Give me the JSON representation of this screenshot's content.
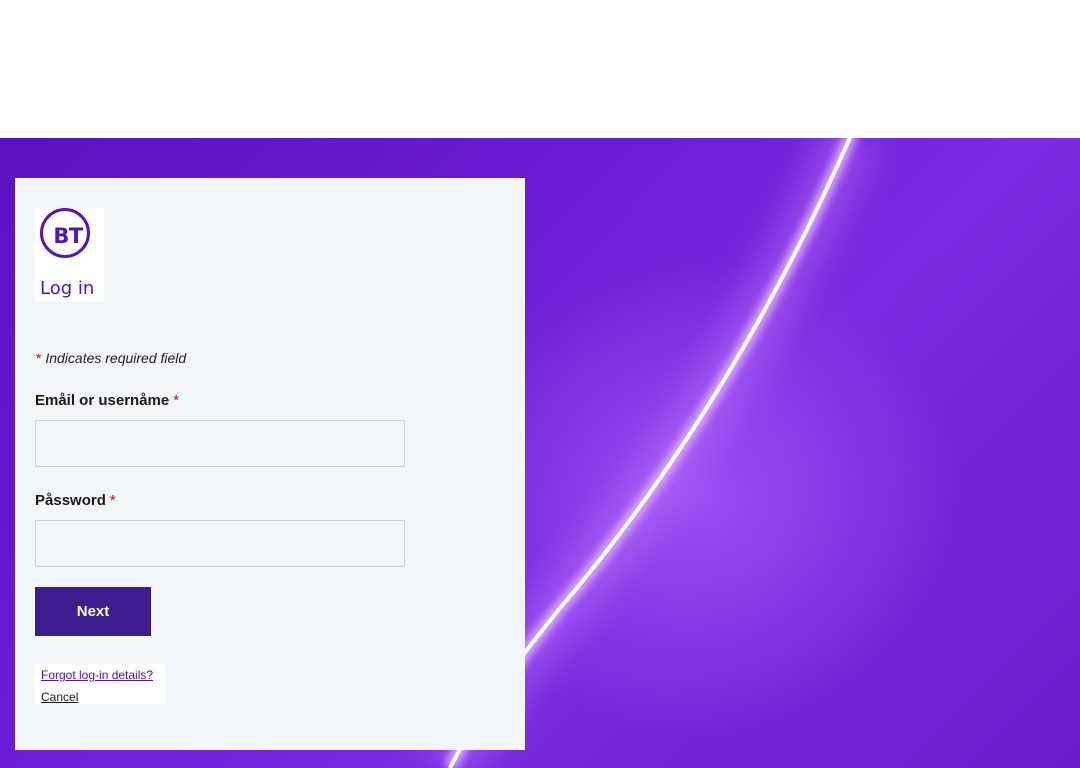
{
  "brand": {
    "logo_text": "BT",
    "title": "Log in"
  },
  "form": {
    "required_note": "Indicates required field",
    "required_marker": "*",
    "email_label": "Emåil or usernåme",
    "email_value": "",
    "password_label": "Påssword",
    "password_value": "",
    "next_label": "Next"
  },
  "links": {
    "forgot": "Forgot log-in details?",
    "cancel": "Cancel"
  },
  "colors": {
    "brand_purple": "#5514b4",
    "button": "#3d1c8f",
    "required": "#e60014",
    "background_hero": "#6a1cd2"
  }
}
